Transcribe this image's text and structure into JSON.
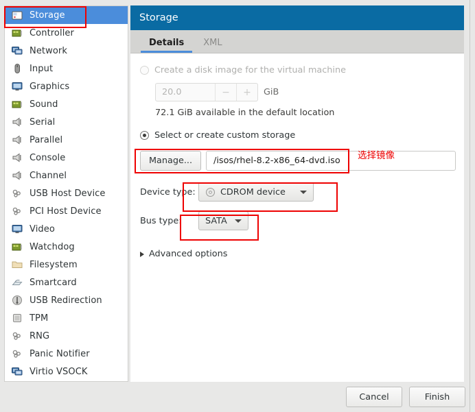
{
  "sidebar": {
    "items": [
      {
        "label": "Storage",
        "icon": "storage-icon",
        "selected": true
      },
      {
        "label": "Controller",
        "icon": "controller-icon",
        "selected": false
      },
      {
        "label": "Network",
        "icon": "network-icon",
        "selected": false
      },
      {
        "label": "Input",
        "icon": "input-mouse-icon",
        "selected": false
      },
      {
        "label": "Graphics",
        "icon": "graphics-display-icon",
        "selected": false
      },
      {
        "label": "Sound",
        "icon": "sound-card-icon",
        "selected": false
      },
      {
        "label": "Serial",
        "icon": "serial-port-icon",
        "selected": false
      },
      {
        "label": "Parallel",
        "icon": "parallel-port-icon",
        "selected": false
      },
      {
        "label": "Console",
        "icon": "console-port-icon",
        "selected": false
      },
      {
        "label": "Channel",
        "icon": "channel-port-icon",
        "selected": false
      },
      {
        "label": "USB Host Device",
        "icon": "usb-host-device-icon",
        "selected": false
      },
      {
        "label": "PCI Host Device",
        "icon": "pci-host-device-icon",
        "selected": false
      },
      {
        "label": "Video",
        "icon": "video-icon",
        "selected": false
      },
      {
        "label": "Watchdog",
        "icon": "watchdog-icon",
        "selected": false
      },
      {
        "label": "Filesystem",
        "icon": "folder-icon",
        "selected": false
      },
      {
        "label": "Smartcard",
        "icon": "smartcard-icon",
        "selected": false
      },
      {
        "label": "USB Redirection",
        "icon": "usb-redirection-icon",
        "selected": false
      },
      {
        "label": "TPM",
        "icon": "tpm-chip-icon",
        "selected": false
      },
      {
        "label": "RNG",
        "icon": "rng-icon",
        "selected": false
      },
      {
        "label": "Panic Notifier",
        "icon": "panic-notifier-icon",
        "selected": false
      },
      {
        "label": "Virtio VSOCK",
        "icon": "virtio-vsock-icon",
        "selected": false
      }
    ]
  },
  "panel": {
    "title": "Storage",
    "tabs": [
      {
        "label": "Details",
        "active": true
      },
      {
        "label": "XML",
        "active": false
      }
    ]
  },
  "form": {
    "create_disk": {
      "label": "Create a disk image for the virtual machine",
      "selected": false,
      "disabled": true
    },
    "size": {
      "value": "20.0",
      "unit": "GiB",
      "decrement": "−",
      "increment": "+",
      "available_note": "72.1 GiB available in the default location"
    },
    "custom_storage": {
      "label": "Select or create custom storage",
      "selected": true
    },
    "manage_button": "Manage...",
    "path_value": "/isos/rhel-8.2-x86_64-dvd.iso",
    "device_type": {
      "label": "Device type:",
      "value": "CDROM device",
      "icon": "cdrom-disc-icon"
    },
    "bus_type": {
      "label": "Bus type:",
      "value": "SATA"
    },
    "advanced_options": {
      "label": "Advanced options",
      "expanded": false
    }
  },
  "footer": {
    "cancel_label": "Cancel",
    "finish_label": "Finish"
  },
  "annotations": {
    "select_image_note": "选择镜像",
    "color": "#ee0000"
  }
}
